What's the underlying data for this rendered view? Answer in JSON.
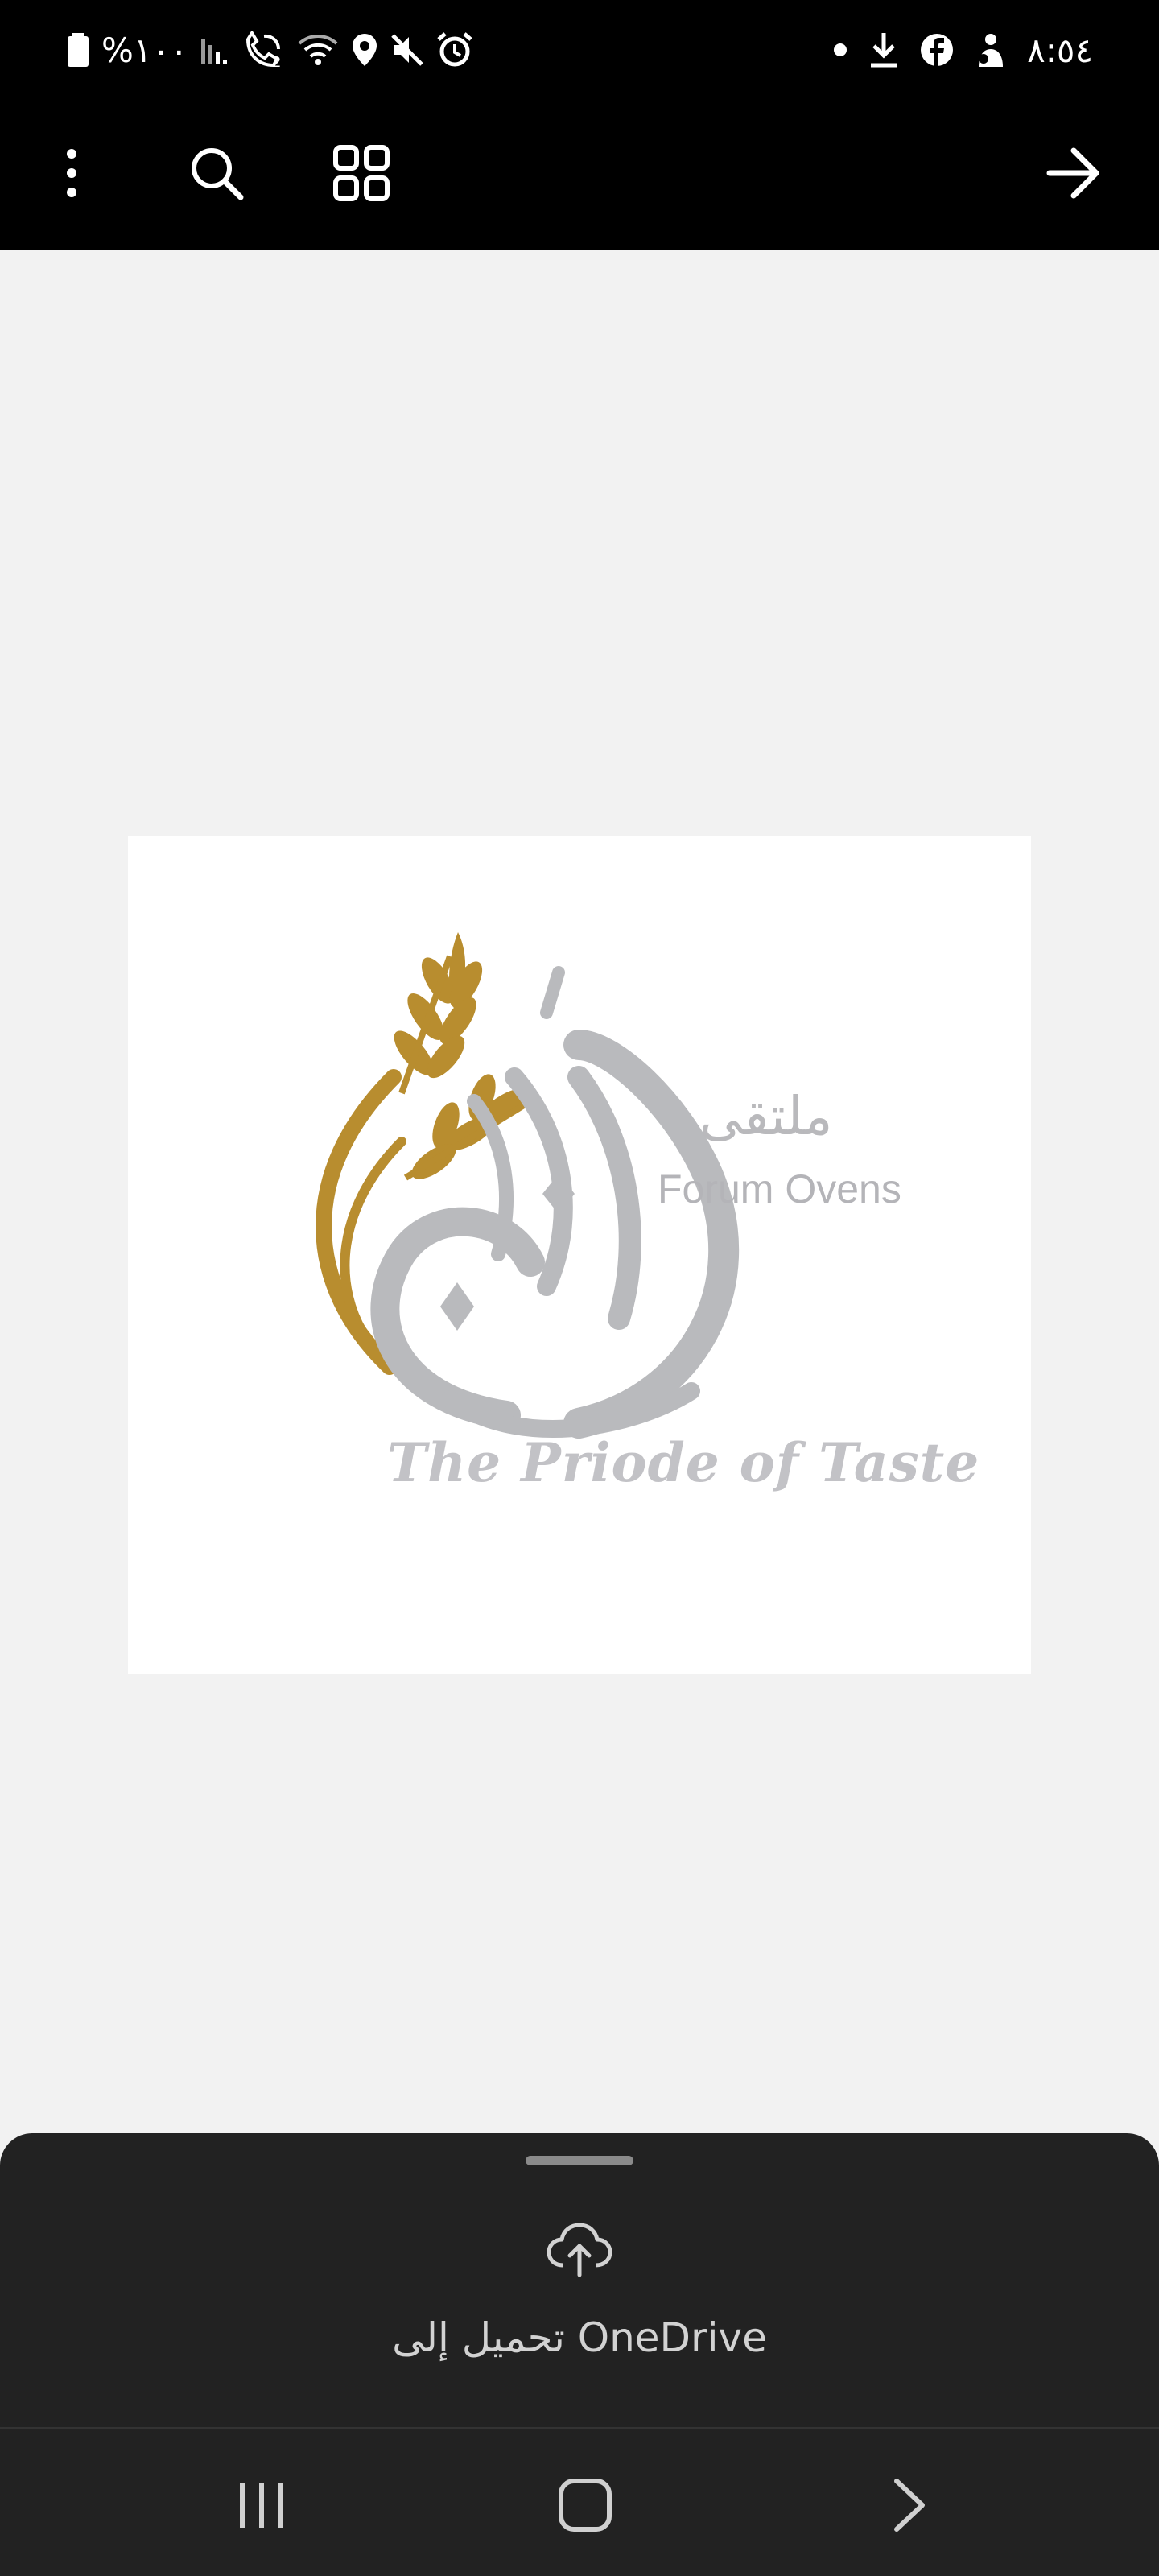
{
  "status_bar": {
    "battery_text": "%١٠٠",
    "time": "٨:٥٤",
    "icons": [
      "battery-icon",
      "signal-icon",
      "wifi-calling-icon",
      "wifi-icon",
      "location-icon",
      "mute-icon",
      "alarm-icon",
      "dot-icon",
      "download-icon",
      "facebook-icon",
      "notification-app-icon"
    ]
  },
  "toolbar": {
    "icons": [
      "more-vert-icon",
      "search-icon",
      "grid-view-icon",
      "arrow-forward-icon"
    ]
  },
  "document": {
    "brand_arabic": "ملتقى",
    "brand_english": "Forum Ovens",
    "tagline": "The Priode of Taste",
    "colors": {
      "wheat": "#b88d2f",
      "calligraphy": "#b9babd",
      "page": "#ffffff"
    }
  },
  "bottom_sheet": {
    "upload_label": "تحميل إلى OneDrive",
    "upload_icon": "cloud-upload-icon"
  },
  "nav_bar": {
    "icons": [
      "recents-icon",
      "home-icon",
      "back-icon"
    ]
  },
  "colors": {
    "status_bg": "#000000",
    "content_bg": "#f2f2f2",
    "sheet_bg": "#222222"
  }
}
